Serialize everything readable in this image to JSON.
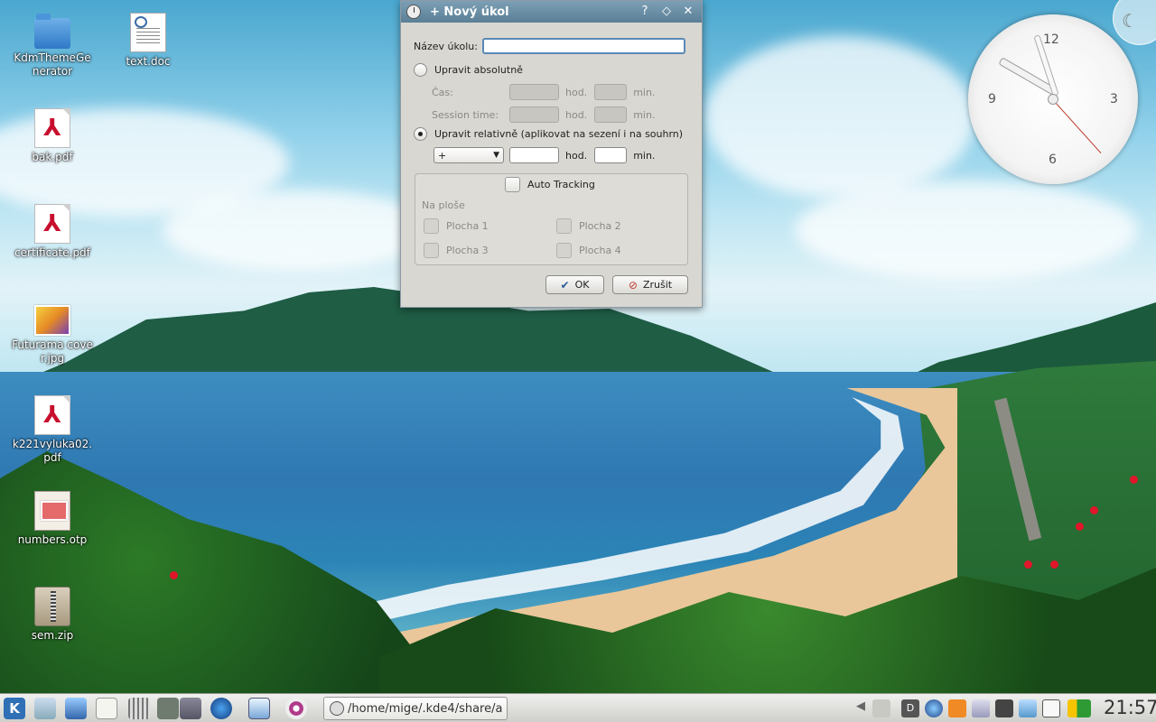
{
  "desktop": {
    "icons": [
      {
        "label": "KdmThemeGenerator",
        "type": "folder"
      },
      {
        "label": "text.doc",
        "type": "document"
      },
      {
        "label": "bak.pdf",
        "type": "pdf"
      },
      {
        "label": "certificate.pdf",
        "type": "pdf"
      },
      {
        "label": "Futurama cover.jpg",
        "type": "image"
      },
      {
        "label": "k221vyluka02.pdf",
        "type": "pdf"
      },
      {
        "label": "numbers.otp",
        "type": "presentation"
      },
      {
        "label": "sem.zip",
        "type": "archive"
      }
    ]
  },
  "clock_widget": {
    "numbers": [
      "12",
      "3",
      "6",
      "9"
    ]
  },
  "dialog": {
    "title": "+ Nový úkol",
    "buttons": {
      "help": "?",
      "shade": "◇",
      "close": "✕"
    },
    "task_name_label": "Název úkolu:",
    "task_name_value": "",
    "absolute_label": "Upravit absolutně",
    "absolute_checked": false,
    "time_label": "Čas:",
    "session_time_label": "Session time:",
    "hours_unit": "hod.",
    "minutes_unit": "min.",
    "relative_label": "Upravit relativně (aplikovat na sezení i na souhrn)",
    "relative_checked": true,
    "relative_sign": "+",
    "auto_tracking_label": "Auto Tracking",
    "auto_tracking_checked": false,
    "desktop_group_label": "Na ploše",
    "desktops": [
      "Plocha 1",
      "Plocha 2",
      "Plocha 3",
      "Plocha 4"
    ],
    "ok_label": "OK",
    "cancel_label": "Zrušit"
  },
  "taskbar": {
    "task_label": "/home/mige/.kde4/share/a",
    "time": "21:57",
    "launchers": [
      "kde-menu-icon",
      "computer-icon",
      "home-folder-icon",
      "text-editor-icon",
      "calculator-icon",
      "file-manager-icon",
      "pager-icon",
      "globe-icon",
      "notes-icon",
      "eye-icon"
    ],
    "tray": [
      "show-hidden-icon",
      "volume-icon",
      "dictionary-icon",
      "network-icon",
      "rss-icon",
      "clipboard-icon",
      "printer-icon",
      "download-icon",
      "device-icon",
      "battery-icon"
    ]
  },
  "colors": {
    "titlebar": "#6a8fa6",
    "dialog_bg": "#d8d7d1",
    "accent_focus": "#5b89b8"
  }
}
